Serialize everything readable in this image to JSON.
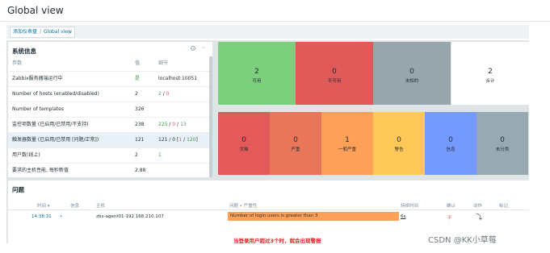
{
  "page": {
    "title": "Global view"
  },
  "breadcrumb": {
    "parent": "添加仪表盘",
    "separator": "/",
    "current": "Global view"
  },
  "system_info": {
    "title": "系统信息",
    "gear_icon": "⚙",
    "more_icon": "···",
    "headers": {
      "param": "参数",
      "value": "值",
      "detail": "细节"
    },
    "rows": [
      {
        "param": "Zabbix服务器端运行中",
        "value": "是",
        "detail_a": "localhost:10051",
        "detail_b": "",
        "detail_c": "",
        "detail_d": "",
        "detail_e": "",
        "detail_f": "",
        "detail_g": ""
      },
      {
        "param": "Number of hosts (enabled/disabled)",
        "value": "2",
        "detail_a": "2",
        "detail_b": " / ",
        "detail_c": "0",
        "detail_d": "",
        "detail_e": "",
        "detail_f": "",
        "detail_g": ""
      },
      {
        "param": "Number of templates",
        "value": "326",
        "detail_a": "",
        "detail_b": "",
        "detail_c": "",
        "detail_d": "",
        "detail_e": "",
        "detail_f": "",
        "detail_g": ""
      },
      {
        "param": "监控项数量 (已启用/已禁用/不支持)",
        "value": "238",
        "detail_a": "225",
        "detail_b": " / ",
        "detail_c": "0",
        "detail_d": " / ",
        "detail_e": "13",
        "detail_f": "",
        "detail_g": ""
      },
      {
        "param": "触发器数量 (已启用/已禁用 [问题/正常])",
        "value": "121",
        "detail_a": "121",
        "detail_b": " / ",
        "detail_c": "0",
        "detail_d": " [",
        "detail_e": "1",
        "detail_f": " / ",
        "detail_g": "120"
      },
      {
        "param": "用户数(线上)",
        "value": "2",
        "detail_a": "1",
        "detail_b": "",
        "detail_c": "",
        "detail_d": "",
        "detail_e": "",
        "detail_f": "",
        "detail_g": ""
      },
      {
        "param": "要求的主机性能, 每秒新值",
        "value": "2.88",
        "detail_a": "",
        "detail_b": "",
        "detail_c": "",
        "detail_d": "",
        "detail_e": "",
        "detail_f": "",
        "detail_g": ""
      }
    ],
    "trigger_close_bracket": "]"
  },
  "host_availability": [
    {
      "count": "2",
      "label": "可用",
      "color": "#7ccf7c"
    },
    {
      "count": "0",
      "label": "不可用",
      "color": "#e05a5a"
    },
    {
      "count": "0",
      "label": "未知的",
      "color": "#97a6ad"
    },
    {
      "count": "2",
      "label": "合计",
      "color": "#ffffff"
    }
  ],
  "problems_by_severity": [
    {
      "count": "0",
      "label": "灾难",
      "color": "#e45959"
    },
    {
      "count": "0",
      "label": "严重",
      "color": "#e97659"
    },
    {
      "count": "1",
      "label": "一般严重",
      "color": "#ffa059"
    },
    {
      "count": "0",
      "label": "警告",
      "color": "#ffc859"
    },
    {
      "count": "0",
      "label": "信息",
      "color": "#7499ff"
    },
    {
      "count": "0",
      "label": "未分类",
      "color": "#97aab3"
    }
  ],
  "problems": {
    "title": "问题",
    "headers": {
      "time": "时间 ▾",
      "info": "信息",
      "host": "主机",
      "problem": "问题 • 严重性",
      "duration": "持续时间",
      "ack": "确认",
      "actions": "动作",
      "tags": "标记"
    },
    "row": {
      "time": "14:38:31",
      "bullet": "•",
      "host": "zbx-agent01-192.168.210.107",
      "problem": "Number of login users is greater than 3",
      "duration": "6s",
      "ack": "不",
      "action_icon": "⤵"
    }
  },
  "annotation": "当登录用户超过3个时，就会出现警报",
  "watermark": "CSDN @KK小草莓"
}
